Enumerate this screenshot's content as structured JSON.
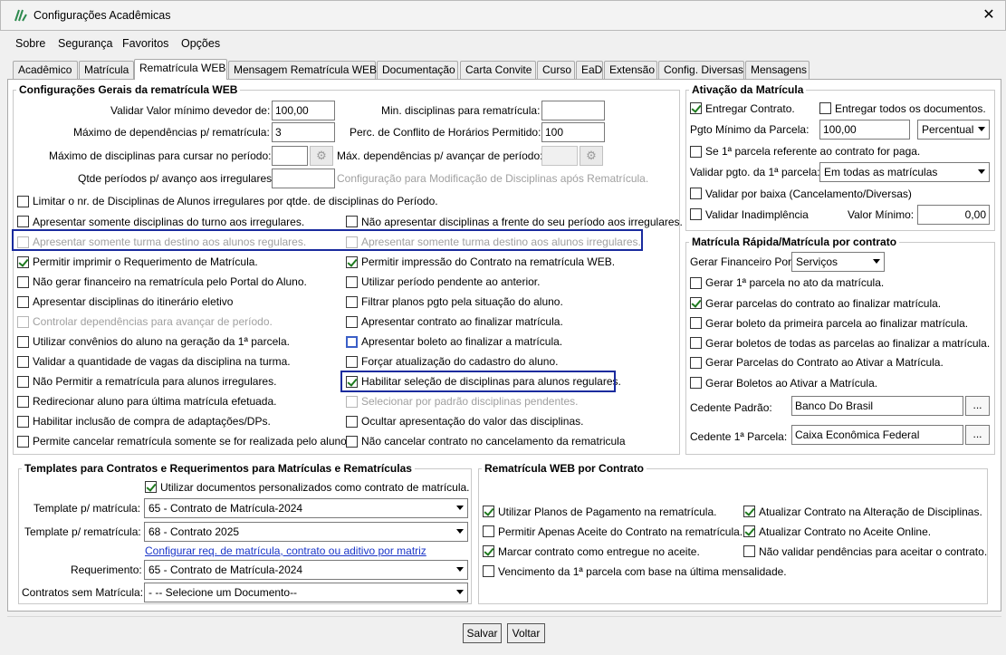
{
  "window": {
    "title": "Configurações Acadêmicas",
    "close": "✕"
  },
  "menu": [
    "Sobre",
    "Segurança",
    "Favoritos",
    "Opções"
  ],
  "tabs": [
    "Acadêmico",
    "Matrícula",
    "Rematrícula WEB",
    "Mensagem Rematrícula WEB",
    "Documentação",
    "Carta Convite",
    "Curso",
    "EaD",
    "Extensão",
    "Config. Diversas",
    "Mensagens"
  ],
  "geral": {
    "title": "Configurações Gerais da rematrícula WEB",
    "validar_label": "Validar Valor mínimo devedor de:",
    "validar_value": "100,00",
    "maxdep_label": "Máximo de dependências p/ rematrícula:",
    "maxdep_value": "3",
    "maxdisc_label": "Máximo de disciplinas para cursar no período:",
    "maxdisc_value": "",
    "qtde_label": "Qtde períodos p/ avanço aos irregulares:",
    "qtde_value": "",
    "mindisc_label": "Min. disciplinas para rematrícula:",
    "mindisc_value": "",
    "perc_label": "Perc. de Conflito de Horários Permitido:",
    "perc_value": "100",
    "maxdepav_label": "Máx. dependências p/ avançar de período:",
    "maxdepav_value": "",
    "config_mod": "Configuração para Modificação de Disciplinas após Rematrícula.",
    "limitar": "Limitar o nr. de Disciplinas de Alunos irregulares por qtde. de disciplinas do Período.",
    "left": [
      "Apresentar somente disciplinas do turno aos irregulares.",
      "Apresentar somente turma destino aos alunos regulares.",
      "Permitir imprimir o Requerimento de Matrícula.",
      "Não gerar financeiro na rematrícula pelo Portal do Aluno.",
      "Apresentar disciplinas do itinerário eletivo",
      "Controlar dependências para avançar de período.",
      "Utilizar convênios do aluno na geração da 1ª parcela.",
      "Validar a quantidade de vagas da disciplina na turma.",
      "Não Permitir a rematrícula para alunos irregulares.",
      "Redirecionar aluno para última matrícula efetuada.",
      "Habilitar inclusão de compra de adaptações/DPs.",
      "Permite cancelar rematrícula somente se for realizada pelo aluno."
    ],
    "right": [
      "Não apresentar disciplinas a frente do seu período aos irregulares.",
      "Apresentar somente turma destino aos alunos irregulares.",
      "Permitir impressão do Contrato na rematrícula WEB.",
      "Utilizar período pendente ao anterior.",
      "Filtrar planos pgto pela situação do aluno.",
      "Apresentar contrato ao finalizar matrícula.",
      "Apresentar boleto ao finalizar a matrícula.",
      "Forçar atualização do cadastro do aluno.",
      "Habilitar seleção de disciplinas para alunos regulares.",
      "Selecionar por padrão disciplinas pendentes.",
      "Ocultar apresentação do valor das disciplinas.",
      "Não cancelar contrato no cancelamento da rematricula"
    ]
  },
  "ativacao": {
    "title": "Ativação da Matrícula",
    "entregar": "Entregar Contrato.",
    "entregar_todos": "Entregar todos os documentos.",
    "pgto_label": "Pgto Mínimo da Parcela:",
    "pgto_value": "100,00",
    "pgto_tipo": "Percentual",
    "se1": "Se 1ª parcela referente ao contrato for paga.",
    "validar1_label": "Validar pgto. da 1ª parcela:",
    "validar1_value": "Em todas as matrículas",
    "baixa": "Validar por baixa (Cancelamento/Diversas)",
    "inad": "Validar Inadimplência",
    "vmin_label": "Valor Mínimo:",
    "vmin_value": "0,00"
  },
  "rapida": {
    "title": "Matrícula Rápida/Matrícula por contrato",
    "gerar_label": "Gerar Financeiro Por:",
    "gerar_value": "Serviços",
    "items": [
      "Gerar 1ª parcela no ato da matrícula.",
      "Gerar parcelas do contrato ao finalizar matrícula.",
      "Gerar boleto da primeira parcela ao finalizar matrícula.",
      "Gerar boletos de todas as parcelas ao finalizar a matrícula.",
      "Gerar Parcelas do Contrato ao Ativar a Matrícula.",
      "Gerar Boletos ao Ativar a Matrícula."
    ],
    "cedente_label": "Cedente Padrão:",
    "cedente_value": "Banco Do Brasil",
    "cedente1_label": "Cedente 1ª Parcela:",
    "cedente1_value": "Caixa Econômica Federal",
    "dots": "..."
  },
  "templates": {
    "title": "Templates para Contratos e Requerimentos para Matrículas e Rematrículas",
    "utilizar": "Utilizar documentos personalizados como contrato de matrícula.",
    "tm_label": "Template p/ matrícula:",
    "tm_value": "65 - Contrato de Matrícula-2024",
    "tr_label": "Template p/ rematrícula:",
    "tr_value": "68 - Contrato 2025",
    "link": "Configurar req. de matrícula, contrato ou aditivo por matriz",
    "req_label": "Requerimento:",
    "req_value": "65 - Contrato de Matrícula-2024",
    "csm_label": "Contratos sem Matrícula:",
    "csm_value": "- -- Selecione um Documento--"
  },
  "contrato": {
    "title": "Rematrícula WEB por Contrato",
    "items": [
      "Utilizar Planos de Pagamento na rematrícula.",
      "Atualizar Contrato na Alteração de Disciplinas.",
      "Permitir Apenas Aceite do Contrato na rematrícula.",
      "Atualizar Contrato no Aceite Online.",
      "Marcar contrato como entregue no aceite.",
      "Não validar pendências para aceitar o contrato.",
      "Vencimento da 1ª parcela com base na última mensalidade."
    ]
  },
  "buttons": {
    "salvar": "Salvar",
    "voltar": "Voltar"
  }
}
